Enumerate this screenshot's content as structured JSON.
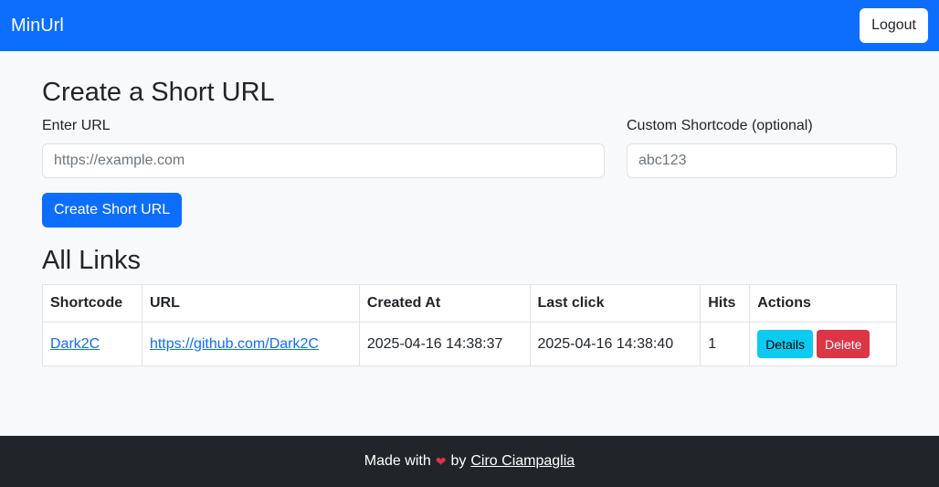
{
  "navbar": {
    "brand": "MinUrl",
    "logout_label": "Logout"
  },
  "create_form": {
    "title": "Create a Short URL",
    "url_label": "Enter URL",
    "url_placeholder": "https://example.com",
    "shortcode_label": "Custom Shortcode (optional)",
    "shortcode_placeholder": "abc123",
    "submit_label": "Create Short URL"
  },
  "links": {
    "title": "All Links",
    "columns": [
      "Shortcode",
      "URL",
      "Created At",
      "Last click",
      "Hits",
      "Actions"
    ],
    "rows": [
      {
        "shortcode": "Dark2C",
        "url": "https://github.com/Dark2C",
        "created_at": "2025-04-16 14:38:37",
        "last_click": "2025-04-16 14:38:40",
        "hits": "1",
        "details_label": "Details",
        "delete_label": "Delete"
      }
    ]
  },
  "footer": {
    "prefix": "Made with",
    "heart_icon": "heart-icon",
    "by": "by",
    "author": "Ciro Ciampaglia"
  },
  "colors": {
    "primary": "#0d6efd",
    "info": "#0dcaf0",
    "danger": "#dc3545",
    "dark": "#212529"
  }
}
